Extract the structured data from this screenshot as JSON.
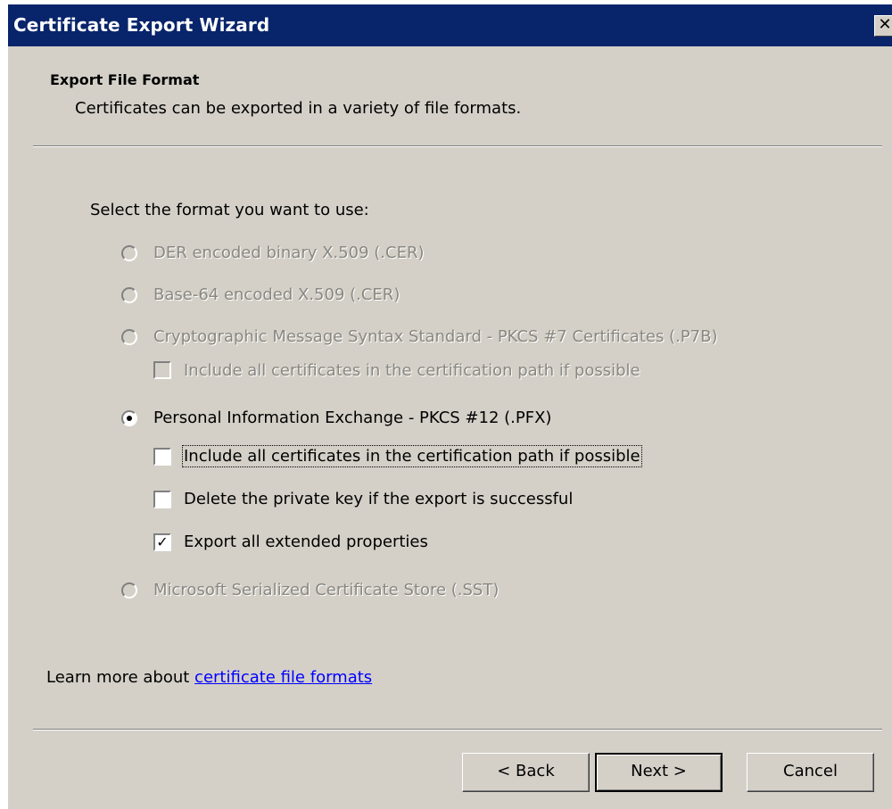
{
  "window": {
    "title": "Certificate Export Wizard",
    "close_glyph": "✕"
  },
  "header": {
    "title": "Export File Format",
    "subtitle": "Certificates can be exported in a variety of file formats."
  },
  "prompt": "Select the format you want to use:",
  "options": {
    "der": {
      "label": "DER encoded binary X.509 (.CER)",
      "selected": false,
      "enabled": false
    },
    "base64": {
      "label": "Base-64 encoded X.509 (.CER)",
      "selected": false,
      "enabled": false
    },
    "pkcs7": {
      "label": "Cryptographic Message Syntax Standard - PKCS #7 Certificates (.P7B)",
      "selected": false,
      "enabled": false
    },
    "pkcs7_include": {
      "label": "Include all certificates in the certification path if possible",
      "checked": false,
      "enabled": false
    },
    "pfx": {
      "label": "Personal Information Exchange - PKCS #12 (.PFX)",
      "selected": true,
      "enabled": true
    },
    "pfx_include": {
      "label": "Include all certificates in the certification path if possible",
      "checked": false,
      "enabled": true
    },
    "pfx_delete_key": {
      "label": "Delete the private key if the export is successful",
      "checked": false,
      "enabled": true
    },
    "pfx_export_props": {
      "label": "Export all extended properties",
      "checked": true,
      "enabled": true
    },
    "sst": {
      "label": "Microsoft Serialized Certificate Store (.SST)",
      "selected": false,
      "enabled": false
    }
  },
  "learn_more": {
    "prefix": "Learn more about ",
    "link_text": "certificate file formats"
  },
  "buttons": {
    "back": "< Back",
    "next": "Next >",
    "cancel": "Cancel"
  },
  "colors": {
    "titlebar": "#08246b",
    "face": "#d4d0c8",
    "link": "#0000ff",
    "disabled_text": "#8a8780"
  }
}
